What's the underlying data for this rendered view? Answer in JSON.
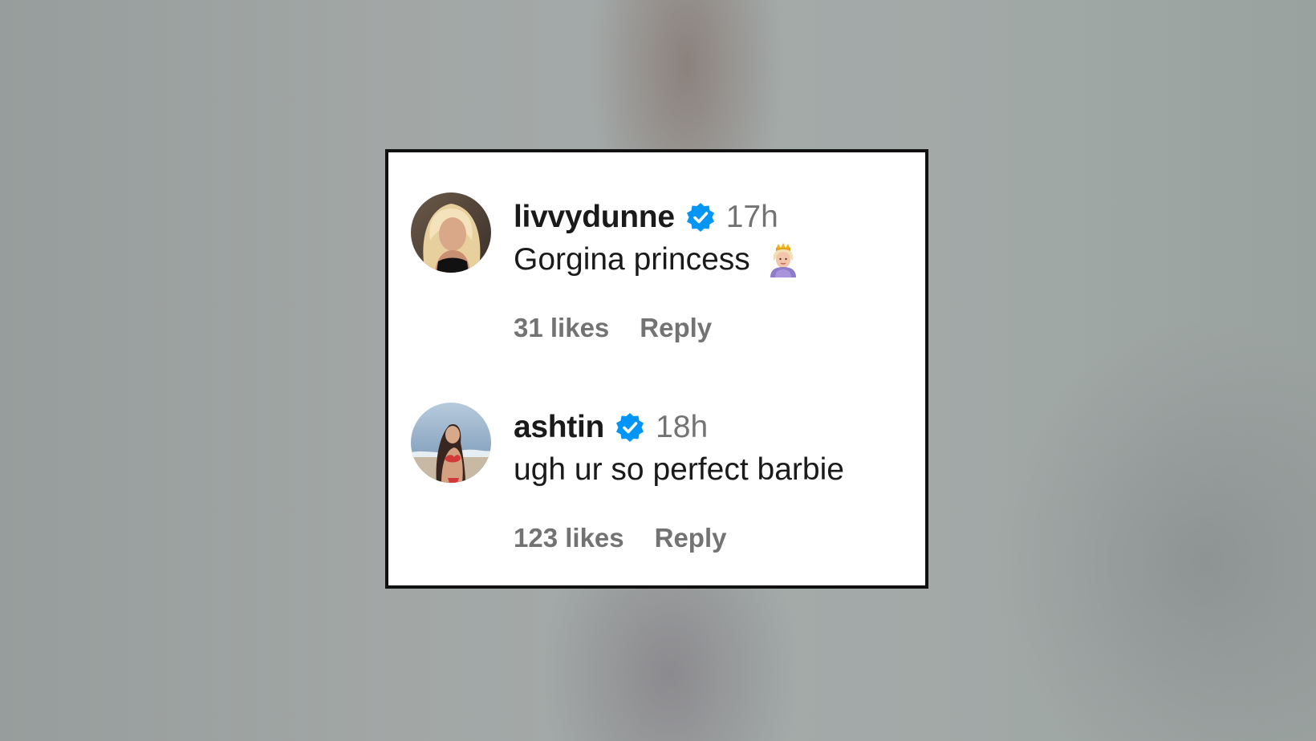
{
  "colors": {
    "verified_blue": "#0095f6",
    "username_text": "#1a1a1a",
    "meta_text": "#737373",
    "card_background": "#ffffff",
    "card_border": "#111111"
  },
  "comments": [
    {
      "username": "livvydunne",
      "verified": true,
      "time": "17h",
      "text": "Gorgina princess",
      "emoji": "princess-emoji",
      "likes": "31 likes",
      "reply_label": "Reply"
    },
    {
      "username": "ashtin",
      "verified": true,
      "time": "18h",
      "text": "ugh ur so perfect barbie",
      "likes": "123 likes",
      "reply_label": "Reply"
    }
  ]
}
